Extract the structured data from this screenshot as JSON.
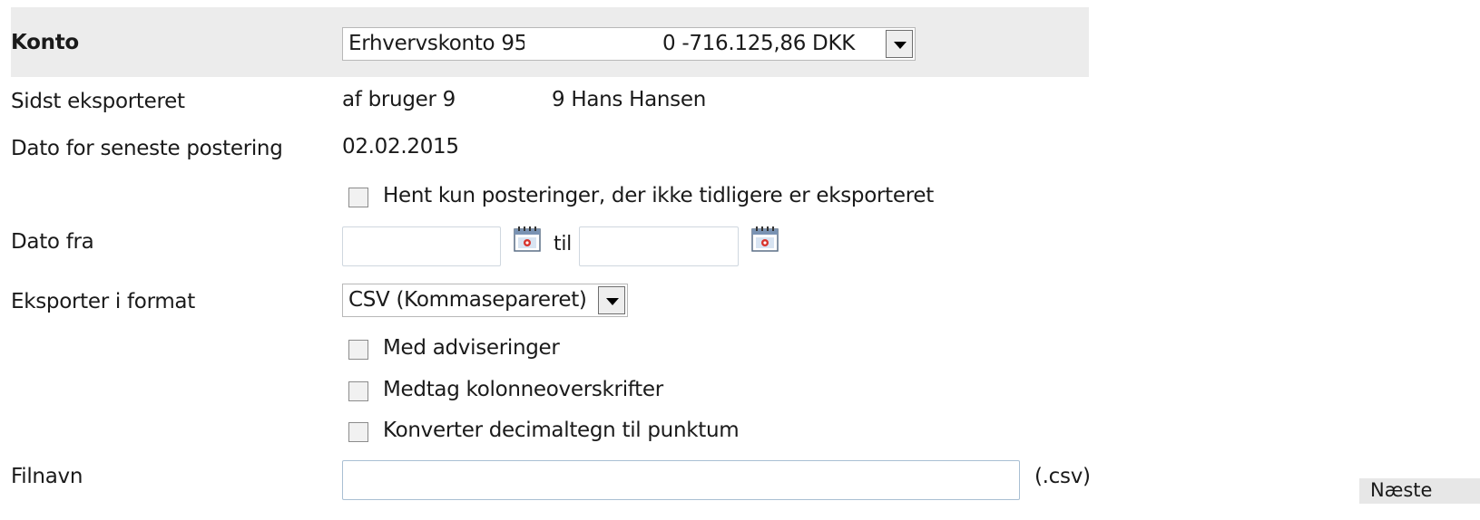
{
  "account": {
    "label": "Konto",
    "selected_prefix": "Erhvervskonto 95",
    "selected_suffix": "0  -716.125,86 DKK"
  },
  "last_export": {
    "label": "Sidst eksporteret",
    "value_prefix": "af bruger 9",
    "value_suffix": "9 Hans Hansen"
  },
  "last_posting": {
    "label": "Dato for seneste postering",
    "value": "02.02.2015"
  },
  "only_new": {
    "label": "Hent kun posteringer, der ikke tidligere er eksporteret",
    "checked": false
  },
  "date_range": {
    "label": "Dato fra",
    "from_value": "",
    "to_label": "til",
    "to_value": "",
    "icon": "calendar-icon"
  },
  "format": {
    "label": "Eksporter i format",
    "selected": "CSV (Kommasepareret)"
  },
  "options": [
    {
      "label": "Med adviseringer",
      "checked": false
    },
    {
      "label": "Medtag kolonneoverskrifter",
      "checked": false
    },
    {
      "label": "Konverter decimaltegn til punktum",
      "checked": false
    }
  ],
  "filename": {
    "label": "Filnavn",
    "value": "",
    "extension": "(.csv)"
  },
  "next_button": {
    "label": "Næste"
  }
}
